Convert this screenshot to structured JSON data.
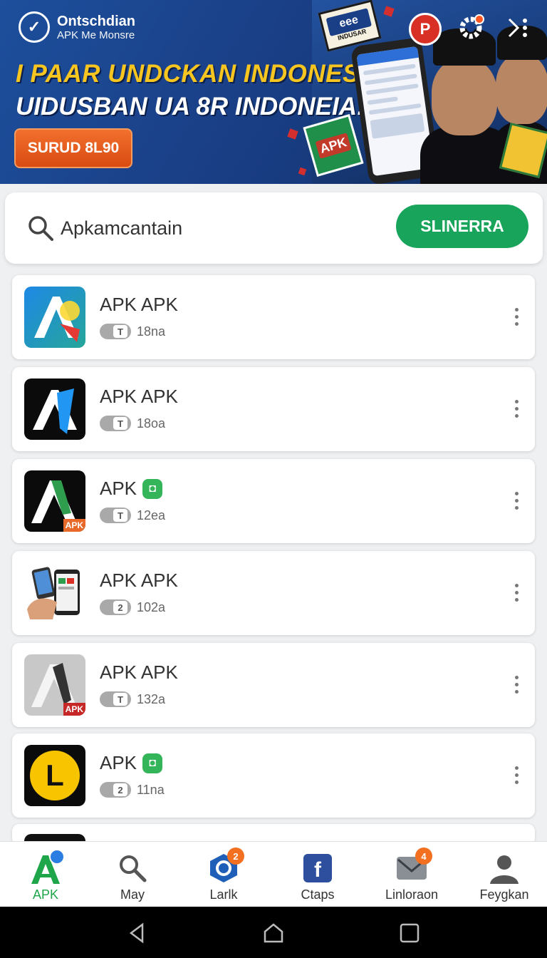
{
  "banner": {
    "brand_name": "Ontschdian",
    "brand_sub": "APK Me Monsre",
    "headline1": "I PAAR UNDCKAN INDONESIA!",
    "headline2": "UIDUSBAN UA 8R INDONEIA!",
    "cta_label": "SURUD 8L90",
    "sign_text": "INDUSAR",
    "sticker_text": "APK"
  },
  "search": {
    "value": "Apkamcantain",
    "button_label": "SLINERRA"
  },
  "apps": [
    {
      "title": "APK APK",
      "meta": "18na",
      "pill": "T",
      "verified": false
    },
    {
      "title": "APK APK",
      "meta": "18oa",
      "pill": "T",
      "verified": false
    },
    {
      "title": "APK",
      "meta": "12ea",
      "pill": "T",
      "verified": true,
      "icon_badge": "APK"
    },
    {
      "title": "APK APK",
      "meta": "102a",
      "pill": "2",
      "verified": false
    },
    {
      "title": "APK APK",
      "meta": "132a",
      "pill": "T",
      "verified": false,
      "icon_badge": "APK"
    },
    {
      "title": "APK",
      "meta": "11na",
      "pill": "2",
      "verified": true,
      "icon_letter": "L"
    }
  ],
  "nav": [
    {
      "label": "APK",
      "active": true
    },
    {
      "label": "May"
    },
    {
      "label": "Larlk",
      "badge": "2"
    },
    {
      "label": "Ctaps"
    },
    {
      "label": "Linloraon",
      "badge": "4"
    },
    {
      "label": "Feygkan"
    }
  ],
  "colors": {
    "accent": "#18a45b",
    "banner": "#1d4f9c",
    "cta": "#e85a1c",
    "headline": "#f7c520"
  }
}
